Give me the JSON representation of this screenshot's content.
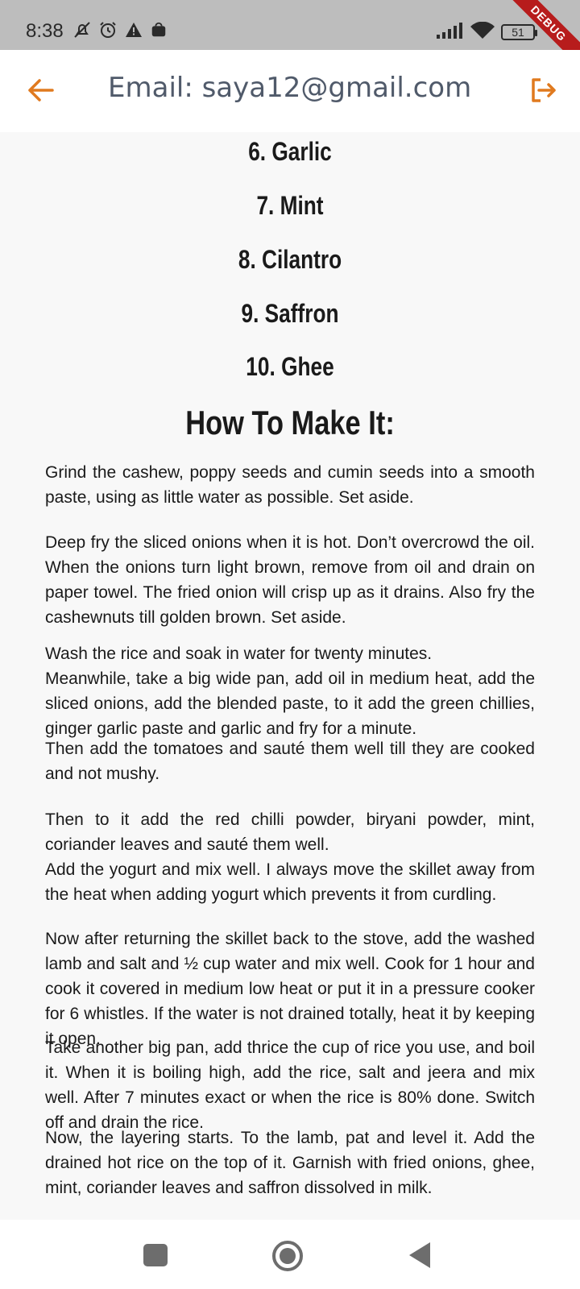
{
  "status_bar": {
    "time": "8:38",
    "left_icons": [
      "notifications-off-icon",
      "alarm-icon",
      "warning-icon",
      "bag-icon"
    ],
    "right_icons": [
      "signal-icon",
      "wifi-icon",
      "battery-icon"
    ],
    "battery_level": "51"
  },
  "debug_banner": "DEBUG",
  "app_bar": {
    "title": "Email: saya12@gmail.com",
    "back_icon": "arrow-left-icon",
    "logout_icon": "logout-icon",
    "accent": "#e07a1f"
  },
  "ingredients": [
    "6. Garlic",
    "7. Mint",
    "8. Cilantro",
    "9. Saffron",
    "10. Ghee"
  ],
  "method": {
    "heading": "How To Make It:",
    "paragraphs": [
      "Grind the cashew, poppy seeds and cumin seeds into a smooth paste, using as little water as possible. Set aside.",
      "Deep fry the sliced onions when it is hot. Don’t overcrowd the oil. When the onions turn light brown, remove from oil and drain on paper towel. The fried onion will crisp up as it drains. Also fry the cashewnuts till golden brown. Set aside.",
      "Wash the rice and soak in water for twenty minutes.",
      "Meanwhile, take a big wide pan, add oil in medium heat, add the sliced onions, add the blended paste, to it add the green chillies, ginger garlic paste and garlic and fry for a minute.",
      "Then add the tomatoes and sauté them well till they are cooked and not mushy.",
      "Then to it add the red chilli powder, biryani powder, mint, coriander leaves and sauté them well.",
      "Add the yogurt and mix well. I always move the skillet away from the heat when adding yogurt which prevents it from curdling.",
      "Now after returning the skillet back to the stove, add the washed lamb and salt and ½ cup water and mix well. Cook for 1 hour and cook it covered in medium low heat or put it in a pressure cooker for 6 whistles. If the water is not drained totally, heat it by keeping it open.",
      "Take another big pan, add thrice the cup of rice you use, and boil it. When it is boiling high, add the rice, salt and jeera and mix well. After 7 minutes exact or when the rice is 80% done. Switch off and drain the rice.",
      "Now, the layering starts. To the lamb, pat and level it. Add the drained hot rice on the top of it. Garnish with fried onions, ghee, mint, coriander leaves and saffron dissolved in milk."
    ]
  },
  "nav_bar": {
    "icons": [
      "recents-square-icon",
      "home-circle-icon",
      "back-triangle-icon"
    ]
  }
}
